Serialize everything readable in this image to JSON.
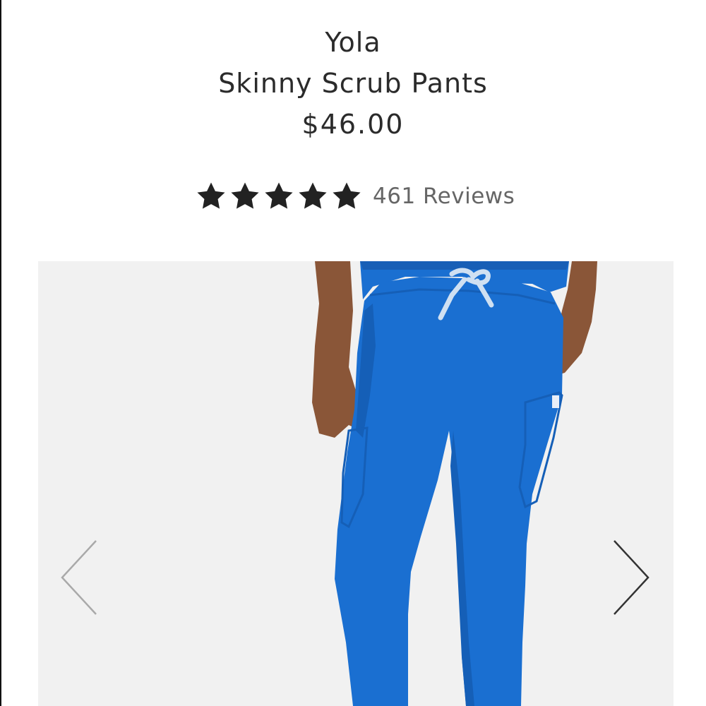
{
  "product": {
    "brand": "Yola",
    "name": "Skinny Scrub Pants",
    "price": "$46.00"
  },
  "rating": {
    "stars": 5,
    "max_stars": 5,
    "reviews_label": "461 Reviews"
  },
  "gallery": {
    "image_subject": "royal blue skinny scrub pants",
    "prev_icon": "chevron-left-icon",
    "next_icon": "chevron-right-icon"
  },
  "colors": {
    "text": "#2b2b2b",
    "muted": "#666666",
    "star": "#222222",
    "gallery_bg": "#f1f1f1",
    "pants_blue": "#1a6fd1"
  }
}
